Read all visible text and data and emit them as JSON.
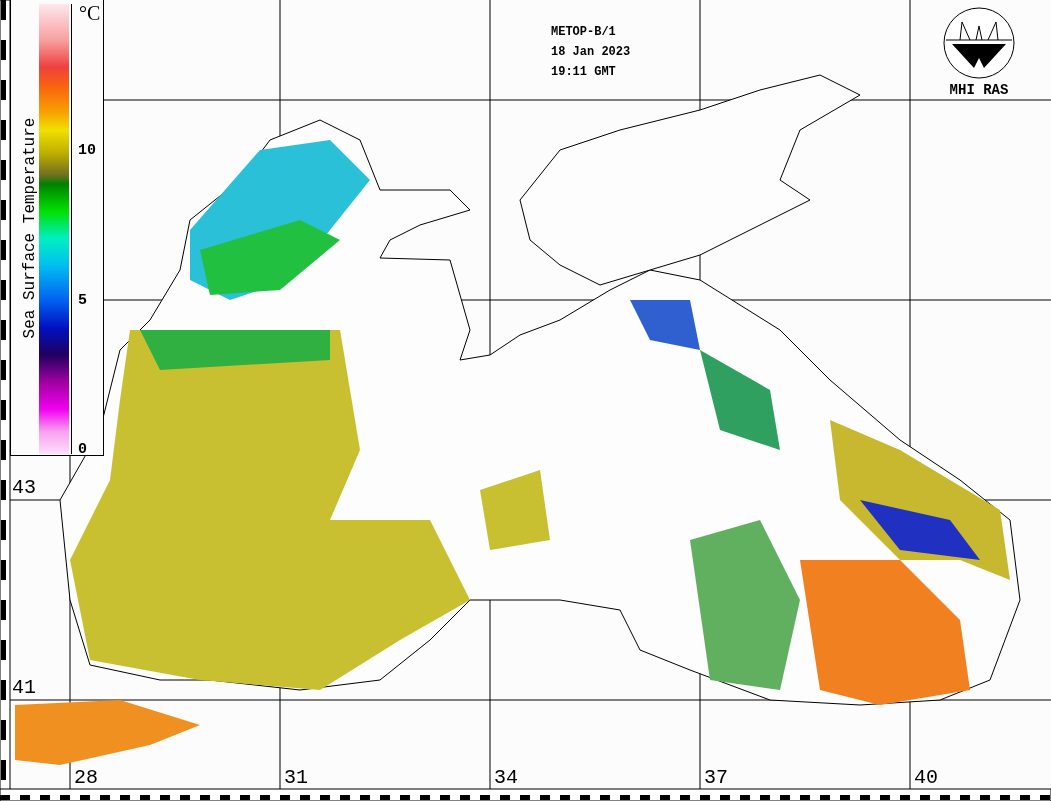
{
  "header": {
    "lines": [
      "METOP-B/1",
      "18 Jan 2023",
      "19:11 GMT"
    ]
  },
  "logo": {
    "label": "MHI RAS"
  },
  "legend": {
    "title": "Sea Surface Temperature",
    "unit": "°C",
    "ticks": [
      "10",
      "5",
      "0"
    ]
  },
  "latitudes": [
    "43",
    "41"
  ],
  "longitudes": [
    "28",
    "31",
    "34",
    "37",
    "40"
  ]
}
